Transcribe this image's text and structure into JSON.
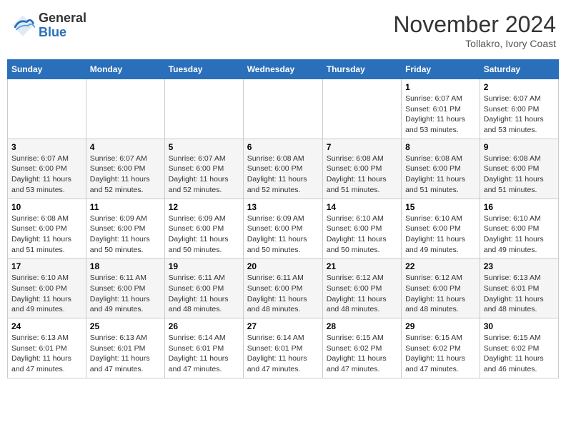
{
  "header": {
    "logo_general": "General",
    "logo_blue": "Blue",
    "month_title": "November 2024",
    "location": "Tollakro, Ivory Coast"
  },
  "weekdays": [
    "Sunday",
    "Monday",
    "Tuesday",
    "Wednesday",
    "Thursday",
    "Friday",
    "Saturday"
  ],
  "weeks": [
    [
      {
        "day": "",
        "info": ""
      },
      {
        "day": "",
        "info": ""
      },
      {
        "day": "",
        "info": ""
      },
      {
        "day": "",
        "info": ""
      },
      {
        "day": "",
        "info": ""
      },
      {
        "day": "1",
        "info": "Sunrise: 6:07 AM\nSunset: 6:01 PM\nDaylight: 11 hours\nand 53 minutes."
      },
      {
        "day": "2",
        "info": "Sunrise: 6:07 AM\nSunset: 6:00 PM\nDaylight: 11 hours\nand 53 minutes."
      }
    ],
    [
      {
        "day": "3",
        "info": "Sunrise: 6:07 AM\nSunset: 6:00 PM\nDaylight: 11 hours\nand 53 minutes."
      },
      {
        "day": "4",
        "info": "Sunrise: 6:07 AM\nSunset: 6:00 PM\nDaylight: 11 hours\nand 52 minutes."
      },
      {
        "day": "5",
        "info": "Sunrise: 6:07 AM\nSunset: 6:00 PM\nDaylight: 11 hours\nand 52 minutes."
      },
      {
        "day": "6",
        "info": "Sunrise: 6:08 AM\nSunset: 6:00 PM\nDaylight: 11 hours\nand 52 minutes."
      },
      {
        "day": "7",
        "info": "Sunrise: 6:08 AM\nSunset: 6:00 PM\nDaylight: 11 hours\nand 51 minutes."
      },
      {
        "day": "8",
        "info": "Sunrise: 6:08 AM\nSunset: 6:00 PM\nDaylight: 11 hours\nand 51 minutes."
      },
      {
        "day": "9",
        "info": "Sunrise: 6:08 AM\nSunset: 6:00 PM\nDaylight: 11 hours\nand 51 minutes."
      }
    ],
    [
      {
        "day": "10",
        "info": "Sunrise: 6:08 AM\nSunset: 6:00 PM\nDaylight: 11 hours\nand 51 minutes."
      },
      {
        "day": "11",
        "info": "Sunrise: 6:09 AM\nSunset: 6:00 PM\nDaylight: 11 hours\nand 50 minutes."
      },
      {
        "day": "12",
        "info": "Sunrise: 6:09 AM\nSunset: 6:00 PM\nDaylight: 11 hours\nand 50 minutes."
      },
      {
        "day": "13",
        "info": "Sunrise: 6:09 AM\nSunset: 6:00 PM\nDaylight: 11 hours\nand 50 minutes."
      },
      {
        "day": "14",
        "info": "Sunrise: 6:10 AM\nSunset: 6:00 PM\nDaylight: 11 hours\nand 50 minutes."
      },
      {
        "day": "15",
        "info": "Sunrise: 6:10 AM\nSunset: 6:00 PM\nDaylight: 11 hours\nand 49 minutes."
      },
      {
        "day": "16",
        "info": "Sunrise: 6:10 AM\nSunset: 6:00 PM\nDaylight: 11 hours\nand 49 minutes."
      }
    ],
    [
      {
        "day": "17",
        "info": "Sunrise: 6:10 AM\nSunset: 6:00 PM\nDaylight: 11 hours\nand 49 minutes."
      },
      {
        "day": "18",
        "info": "Sunrise: 6:11 AM\nSunset: 6:00 PM\nDaylight: 11 hours\nand 49 minutes."
      },
      {
        "day": "19",
        "info": "Sunrise: 6:11 AM\nSunset: 6:00 PM\nDaylight: 11 hours\nand 48 minutes."
      },
      {
        "day": "20",
        "info": "Sunrise: 6:11 AM\nSunset: 6:00 PM\nDaylight: 11 hours\nand 48 minutes."
      },
      {
        "day": "21",
        "info": "Sunrise: 6:12 AM\nSunset: 6:00 PM\nDaylight: 11 hours\nand 48 minutes."
      },
      {
        "day": "22",
        "info": "Sunrise: 6:12 AM\nSunset: 6:00 PM\nDaylight: 11 hours\nand 48 minutes."
      },
      {
        "day": "23",
        "info": "Sunrise: 6:13 AM\nSunset: 6:01 PM\nDaylight: 11 hours\nand 48 minutes."
      }
    ],
    [
      {
        "day": "24",
        "info": "Sunrise: 6:13 AM\nSunset: 6:01 PM\nDaylight: 11 hours\nand 47 minutes."
      },
      {
        "day": "25",
        "info": "Sunrise: 6:13 AM\nSunset: 6:01 PM\nDaylight: 11 hours\nand 47 minutes."
      },
      {
        "day": "26",
        "info": "Sunrise: 6:14 AM\nSunset: 6:01 PM\nDaylight: 11 hours\nand 47 minutes."
      },
      {
        "day": "27",
        "info": "Sunrise: 6:14 AM\nSunset: 6:01 PM\nDaylight: 11 hours\nand 47 minutes."
      },
      {
        "day": "28",
        "info": "Sunrise: 6:15 AM\nSunset: 6:02 PM\nDaylight: 11 hours\nand 47 minutes."
      },
      {
        "day": "29",
        "info": "Sunrise: 6:15 AM\nSunset: 6:02 PM\nDaylight: 11 hours\nand 47 minutes."
      },
      {
        "day": "30",
        "info": "Sunrise: 6:15 AM\nSunset: 6:02 PM\nDaylight: 11 hours\nand 46 minutes."
      }
    ]
  ]
}
